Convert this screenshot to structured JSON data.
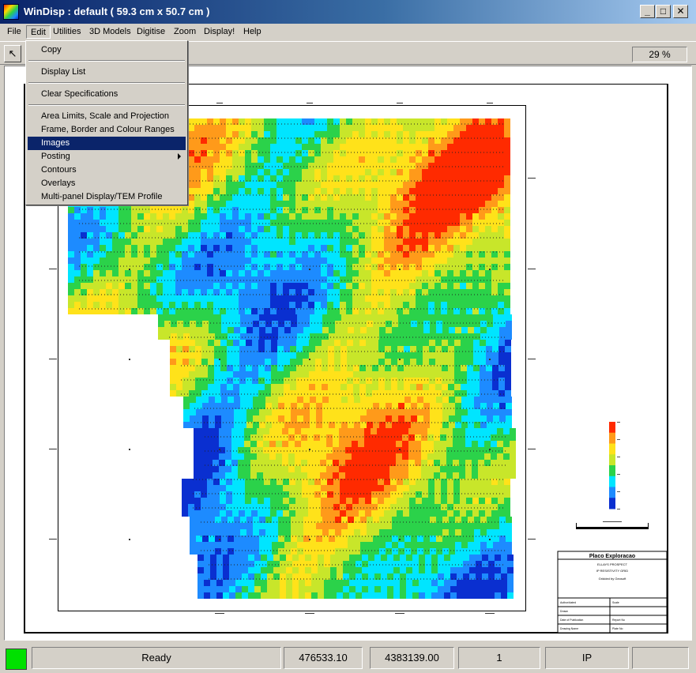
{
  "window": {
    "title": "WinDisp : default ( 59.3 cm x 50.7 cm )",
    "minimize_glyph": "_",
    "maximize_glyph": "□",
    "close_glyph": "✕"
  },
  "menubar": {
    "items": [
      "File",
      "Edit",
      "Utilities",
      "3D Models",
      "Digitise",
      "Zoom",
      "Display!",
      "Help"
    ],
    "active": "Edit"
  },
  "toolbar": {
    "pointer_icon": "arrow-pointer-icon",
    "zoom": "29 %"
  },
  "edit_menu": {
    "items": [
      {
        "label": "Copy"
      },
      {
        "label": "Display List"
      },
      {
        "label": "Clear Specifications"
      },
      {
        "label": "Area Limits, Scale and Projection"
      },
      {
        "label": "Frame, Border and Colour Ranges"
      },
      {
        "label": "Images",
        "highlighted": true
      },
      {
        "label": "Posting",
        "submenu": true
      },
      {
        "label": "Contours"
      },
      {
        "label": "Overlays"
      },
      {
        "label": "Multi-panel Display/TEM Profile"
      }
    ]
  },
  "title_block": {
    "company": "Placo Exploracao",
    "line1": "ELLAYS PROSPECT",
    "line2": "IP RESISTIVITY GRID",
    "line3": "Gridded by Geosoft",
    "rows": [
      [
        "Author/dated",
        "Scale"
      ],
      [
        "Drawn",
        ""
      ],
      [
        "Date of Publication",
        "Report No"
      ],
      [
        "Drawing Name",
        "Plate No"
      ]
    ]
  },
  "colors": {
    "accent": "#0a246a",
    "ramp": [
      "#0a2fd0",
      "#1d8bff",
      "#00e5ff",
      "#2bd24a",
      "#c8e62a",
      "#ffe21a",
      "#ff9a1a",
      "#ff2a00"
    ]
  },
  "status": {
    "message": "Ready",
    "x": "476533.10",
    "y": "4383139.00",
    "layer": "1",
    "mode": "IP",
    "extra": ""
  }
}
